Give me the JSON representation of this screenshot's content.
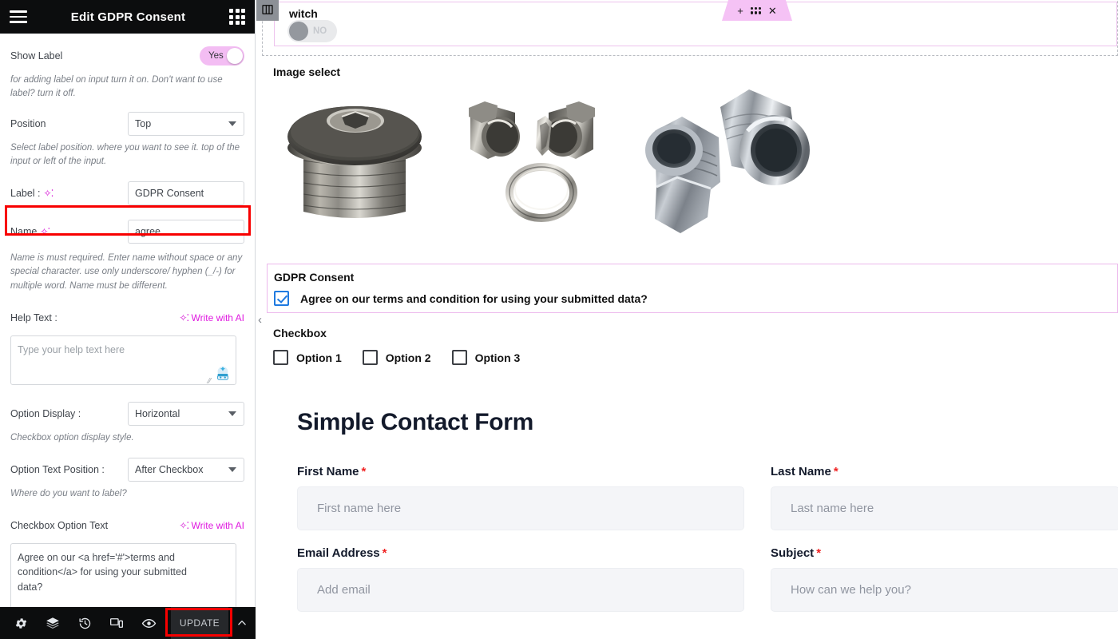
{
  "panel": {
    "title": "Edit GDPR Consent",
    "menu_icon": "hamburger-icon",
    "apps_icon": "grid-icon",
    "controls": {
      "show_label": {
        "label": "Show Label",
        "toggle_value": "Yes",
        "description": "for adding label on input turn it on. Don't want to use label? turn it off."
      },
      "position": {
        "label": "Position",
        "value": "Top",
        "description": "Select label position. where you want to see it. top of the input or left of the input."
      },
      "label_field": {
        "label": "Label :",
        "value": "GDPR Consent"
      },
      "name_field": {
        "label": "Name",
        "value": "agree",
        "description": "Name is must required. Enter name without space or any special character. use only underscore/ hyphen (_/-) for multiple word. Name must be different.",
        "highlighted": true
      },
      "help_text": {
        "label": "Help Text :",
        "ai_link": "Write with AI",
        "placeholder": "Type your help text here",
        "value": ""
      },
      "option_display": {
        "label": "Option Display :",
        "value": "Horizontal",
        "description": "Checkbox option display style."
      },
      "option_text_position": {
        "label": "Option Text Position :",
        "value": "After Checkbox",
        "description": "Where do you want to label?"
      },
      "checkbox_option_text": {
        "label": "Checkbox Option Text",
        "ai_link": "Write with AI",
        "value": "Agree on our <a href='#'>terms and condition</a> for using your submitted data?"
      }
    },
    "footer": {
      "icons": [
        "settings-gear-icon",
        "layers-icon",
        "history-icon",
        "responsive-mode-icon",
        "preview-eye-icon"
      ],
      "update_label": "UPDATE",
      "collapse_icon": "chevron-up-icon"
    }
  },
  "canvas": {
    "collapse_panel_icon": "chevron-left-icon",
    "switch_widget": {
      "label": "witch",
      "toggle_value": "NO",
      "widget_icon": "columns-layout-icon"
    },
    "edit_toolbar": {
      "add_icon": "plus-icon",
      "drag_icon": "drag-handle-icon",
      "close_icon": "close-x-icon"
    },
    "image_select": {
      "title": "Image select",
      "items": [
        "metal-plug-hex-socket",
        "metal-fittings-pair-with-oring",
        "metal-flare-fittings-pair"
      ]
    },
    "gdpr_widget": {
      "title": "GDPR Consent",
      "checkbox_checked": true,
      "checkbox_text": "Agree on our terms and condition for using your submitted data?"
    },
    "checkbox_widget": {
      "title": "Checkbox",
      "options": [
        {
          "label": "Option 1",
          "checked": false
        },
        {
          "label": "Option 2",
          "checked": false
        },
        {
          "label": "Option 3",
          "checked": false
        }
      ]
    },
    "contact_form": {
      "heading": "Simple Contact Form",
      "fields": [
        {
          "label": "First Name",
          "required": "*",
          "placeholder": "First name here"
        },
        {
          "label": "Last Name",
          "required": "*",
          "placeholder": "Last name here"
        },
        {
          "label": "Email Address",
          "required": "*",
          "placeholder": "Add email"
        },
        {
          "label": "Subject",
          "required": "*",
          "placeholder": "How can we help you?"
        }
      ]
    }
  },
  "colors": {
    "accent_pink": "#e01ae0",
    "toggle_on": "#f3bdf3",
    "highlight_red": "#f80000",
    "panel_dark": "#0c0d0e",
    "required_red": "#f02222",
    "checkbox_blue": "#1f7ae0",
    "widget_border_pink": "#ecb8ec"
  }
}
